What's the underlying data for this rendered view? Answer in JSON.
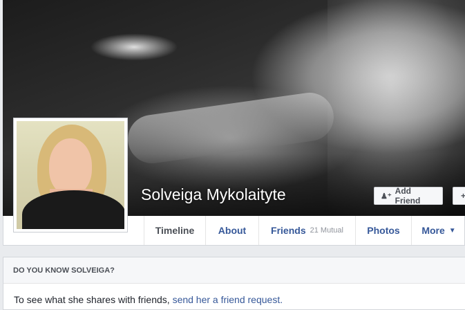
{
  "profile": {
    "name": "Solveiga Mykolaityte"
  },
  "actions": {
    "add_friend_label": "Add Friend",
    "add_friend_icon": "person-plus-icon",
    "more_icon": "plus-icon"
  },
  "nav": {
    "tabs": [
      {
        "label": "Timeline",
        "active": true
      },
      {
        "label": "About"
      },
      {
        "label": "Friends",
        "sub": "21 Mutual"
      },
      {
        "label": "Photos"
      },
      {
        "label": "More",
        "caret": "▼"
      }
    ]
  },
  "know_panel": {
    "heading": "DO YOU KNOW SOLVEIGA?",
    "text": "To see what she shares with friends, ",
    "link": "send her a friend request."
  },
  "colors": {
    "link": "#365899",
    "background": "#e9ebee"
  }
}
